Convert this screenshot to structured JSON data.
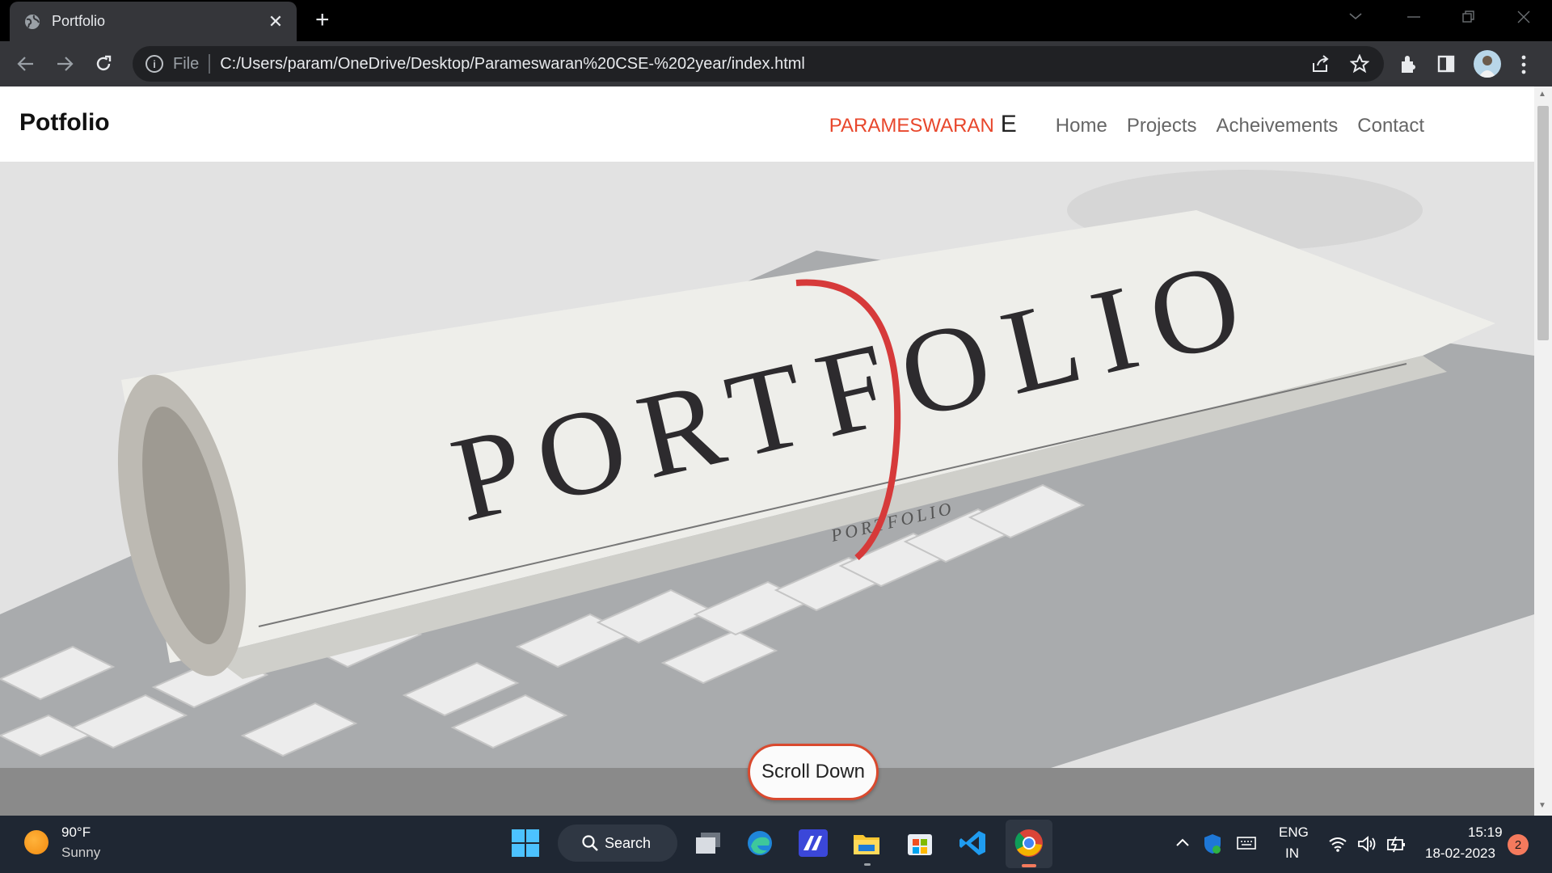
{
  "browser": {
    "tab_title": "Portfolio",
    "tab_close": "✕",
    "new_tab": "+",
    "url_scheme": "File",
    "url": "C:/Users/param/OneDrive/Desktop/Parameswaran%20CSE-%202year/index.html"
  },
  "page": {
    "brand": "Potfolio",
    "nav": {
      "name": "PARAMESWARAN",
      "initial": "E",
      "links": [
        "Home",
        "Projects",
        "Acheivements",
        "Contact"
      ]
    },
    "hero_text_big": "PORTFOLIO",
    "hero_text_small": "PORTFOLIO",
    "scroll_button": "Scroll Down"
  },
  "taskbar": {
    "weather_temp": "90°F",
    "weather_condition": "Sunny",
    "search_label": "Search",
    "lang_top": "ENG",
    "lang_bottom": "IN",
    "time": "15:19",
    "date": "18-02-2023",
    "notification_count": "2"
  },
  "colors": {
    "accent": "#e8472c",
    "taskbar": "#1f2733",
    "tab_bg": "#35363a"
  }
}
